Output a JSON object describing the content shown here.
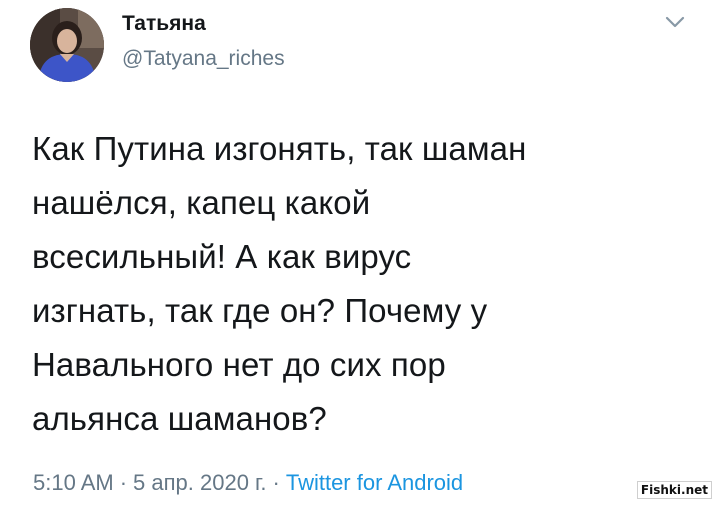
{
  "author": {
    "display_name": "Татьяна",
    "handle": "@Tatyana_riches",
    "avatar": "profile-photo"
  },
  "menu": {
    "icon": "chevron-down-icon"
  },
  "tweet": {
    "text": "Как Путина изгонять, так шаман\nнашёлся, капец какой\nвсесильный! А как вирус\nизгнать, так где он? Почему у\nНавального нет до сих пор\nальянса шаманов?"
  },
  "meta": {
    "time": "5:10 AM",
    "separator": "·",
    "date": "5 апр. 2020 г.",
    "source": "Twitter for Android"
  },
  "watermark": {
    "text": "Fishki.net"
  },
  "colors": {
    "text": "#14171a",
    "secondary": "#657786",
    "link": "#1b95e0"
  }
}
